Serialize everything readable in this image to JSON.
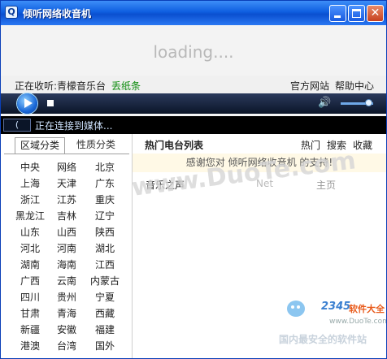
{
  "window": {
    "title": "倾听网络收音机"
  },
  "banner": {
    "loading_text": "loading...."
  },
  "info": {
    "now_label": "正在收听:青檬音乐台",
    "now_station": "丢纸条",
    "official_site": "官方网站",
    "help_center": "帮助中心"
  },
  "status": {
    "box": "(",
    "text": "正在连接到媒体..."
  },
  "tabs": {
    "region": "区域分类",
    "genre": "性质分类"
  },
  "regions": [
    "中央",
    "网络",
    "北京",
    "上海",
    "天津",
    "广东",
    "浙江",
    "江苏",
    "重庆",
    "黑龙江",
    "吉林",
    "辽宁",
    "山东",
    "山西",
    "陕西",
    "河北",
    "河南",
    "湖北",
    "湖南",
    "海南",
    "江西",
    "广西",
    "云南",
    "内蒙古",
    "四川",
    "贵州",
    "宁夏",
    "甘肃",
    "青海",
    "西藏",
    "新疆",
    "安徽",
    "福建",
    "港澳",
    "台湾",
    "国外"
  ],
  "list": {
    "title": "热门电台列表",
    "hot": "热门",
    "search": "搜索",
    "favorites": "收藏",
    "thanks": "感谢您对 倾听网络收音机 的支持!",
    "stations": [
      {
        "name": "音乐之声",
        "net": "Net",
        "home": "主页"
      }
    ]
  },
  "watermarks": {
    "site": "www.DuoTe.com",
    "logo_num": "2345",
    "logo_cn": "软件大全",
    "logo_url": "www.DuoTe.com",
    "slogan": "国内最安全的软件站"
  }
}
